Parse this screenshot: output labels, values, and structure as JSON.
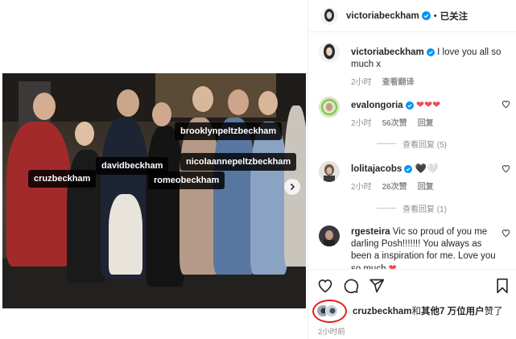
{
  "post": {
    "tags": [
      {
        "name": "tag-cruzbeckham",
        "label": "cruzbeckham"
      },
      {
        "name": "tag-davidbeckham",
        "label": "davidbeckham"
      },
      {
        "name": "tag-brooklynpeltzbeckham",
        "label": "brooklynpeltzbeckham"
      },
      {
        "name": "tag-nicolaannepeltzbeckham",
        "label": "nicolaannepeltzbeckham"
      },
      {
        "name": "tag-romeobeckham",
        "label": "romeobeckham"
      }
    ]
  },
  "header": {
    "username": "victoriabeckham",
    "separator": "•",
    "follow_state": "已关注"
  },
  "caption": {
    "username": "victoriabeckham",
    "text": "I love you all so much x",
    "time": "2小时",
    "translate": "查看翻译"
  },
  "comments": [
    {
      "username": "evalongoria",
      "text": "❤❤❤",
      "time": "2小时",
      "likes": "56次赞",
      "reply": "回复",
      "view_replies": "查看回复 (5)"
    },
    {
      "username": "lolitajacobs",
      "text": "🖤🤍",
      "time": "2小时",
      "likes": "26次赞",
      "reply": "回复",
      "view_replies": "查看回复 (1)"
    },
    {
      "username": "rgesteira",
      "text": "Vic so proud of you me darling Posh!!!!!!! You always as been a inspiration for me. Love you so much",
      "emoji": "❤"
    }
  ],
  "actions": {
    "icons": [
      "heart-icon",
      "comment-icon",
      "share-icon",
      "bookmark-icon"
    ]
  },
  "likes": {
    "liker": "cruzbeckham",
    "mid": "和",
    "others": "其他7 万位用户",
    "suffix": "赞了"
  },
  "timestamp": "2小时前",
  "colors": {
    "verified": "#0095f6",
    "annotation_circle": "#e02020",
    "heart_red": "#ed4956"
  }
}
